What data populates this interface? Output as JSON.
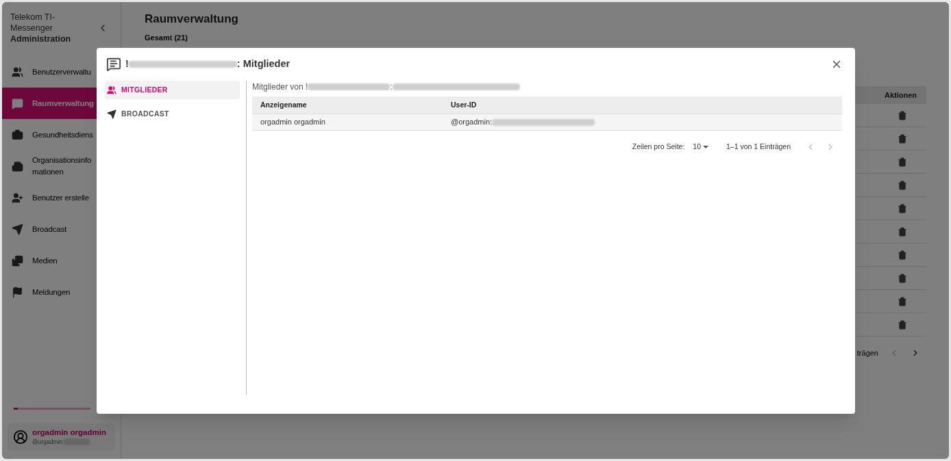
{
  "sidebar": {
    "brand_lines": [
      "Telekom TI-",
      "Messenger"
    ],
    "brand_bold": "Administration",
    "items": [
      {
        "label": "Benutzerverwaltu",
        "selected": false
      },
      {
        "label": "Raumverwaltung",
        "selected": true
      },
      {
        "label": "Gesundheitsdiens",
        "selected": false
      },
      {
        "label": "Organisationsinfo\nmationen",
        "selected": false
      },
      {
        "label": "Benutzer erstelle",
        "selected": false
      },
      {
        "label": "Broadcast",
        "selected": false
      },
      {
        "label": "Medien",
        "selected": false
      },
      {
        "label": "Meldungen",
        "selected": false
      }
    ],
    "progress": {
      "level": 0.05
    },
    "user": {
      "name": "orgadmin orgadmin",
      "id_prefix": "@orgadmin:"
    }
  },
  "main": {
    "title": "Raumverwaltung",
    "count": "Gesamt (21)",
    "actions_header": "Aktionen",
    "pagination_text": "trägen"
  },
  "dialog": {
    "title_prefix": "!",
    "title_suffix": ": Mitglieder",
    "tabs": [
      {
        "label": "MITGLIEDER",
        "selected": true
      },
      {
        "label": "BROADCAST",
        "selected": false
      }
    ],
    "intro_prefix": "Mitglieder von !",
    "intro_middle": ":",
    "columns": [
      "Anzeigename",
      "User-ID"
    ],
    "rows": [
      {
        "name": "orgadmin orgadmin",
        "user_id_prefix": "@orgadmin:"
      }
    ],
    "pagination": {
      "rows_label": "Zeilen pro Seite:",
      "rows_value": "10",
      "range": "1–1 von 1 Einträgen"
    }
  }
}
